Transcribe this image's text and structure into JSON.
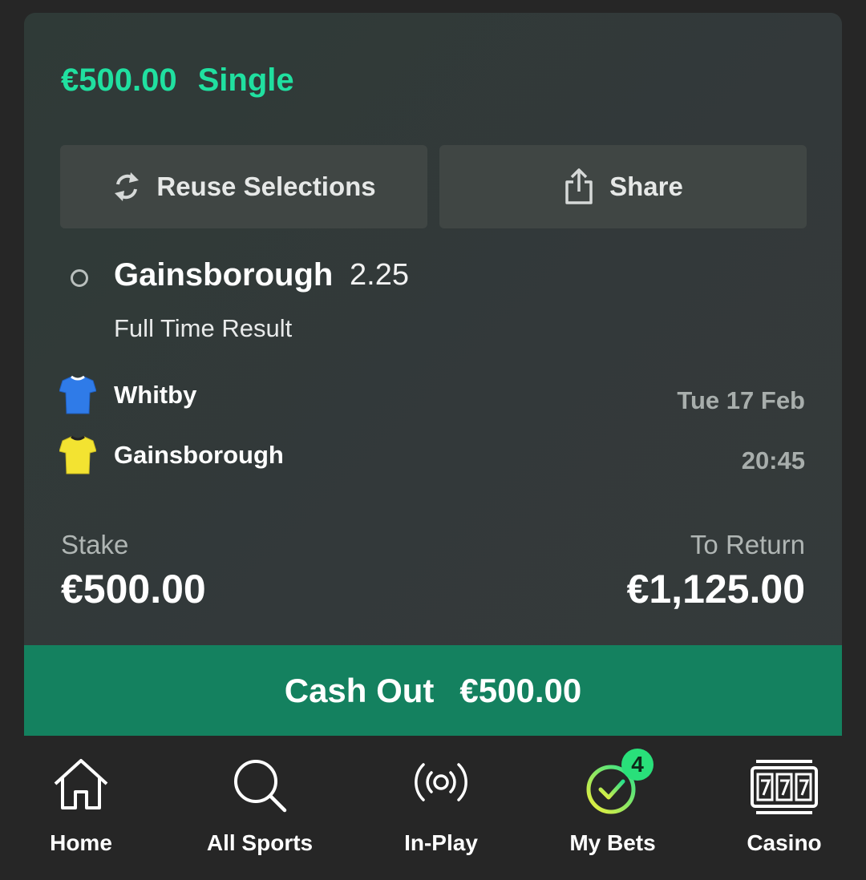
{
  "bet": {
    "amount": "€500.00",
    "type": "Single",
    "reuse_label": "Reuse Selections",
    "share_label": "Share",
    "selection": "Gainsborough",
    "odds": "2.25",
    "market": "Full Time Result",
    "team_home": "Whitby",
    "team_away": "Gainsborough",
    "date": "Tue 17 Feb",
    "time": "20:45",
    "stake_label": "Stake",
    "stake": "€500.00",
    "return_label": "To Return",
    "return": "€1,125.00",
    "cashout_label": "Cash Out",
    "cashout_amount": "€500.00"
  },
  "colors": {
    "accent": "#20e0a0",
    "cashout_bg": "#14815f",
    "home_shirt": "#2f7be8",
    "away_shirt": "#f3e331"
  },
  "icons": {
    "reuse": "refresh-icon",
    "share": "share-icon",
    "home": "home-icon",
    "all_sports": "search-icon",
    "in_play": "broadcast-icon",
    "my_bets": "check-circle-icon",
    "casino": "slot-machine-icon"
  },
  "nav": {
    "home": "Home",
    "all_sports": "All Sports",
    "in_play": "In-Play",
    "my_bets": "My Bets",
    "my_bets_badge": "4",
    "casino": "Casino"
  }
}
